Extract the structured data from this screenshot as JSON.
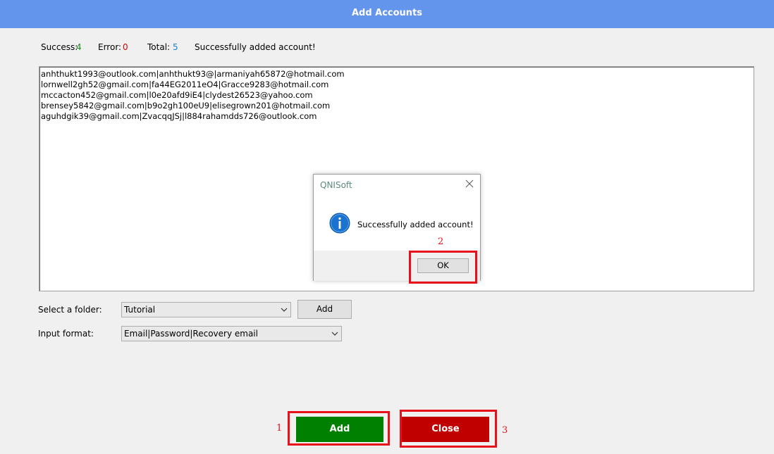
{
  "window": {
    "title": "Add Accounts"
  },
  "stats": {
    "success_label": "Success:",
    "success_value": "4",
    "error_label": "Error:",
    "error_value": "0",
    "total_label": "Total:",
    "total_value": "5",
    "status_message": "Successfully added account!"
  },
  "accounts_text": [
    "anhthukt1993@outlook.com|anhthukt93@|armaniyah65872@hotmail.com",
    "lornwell2gh52@gmail.com|fa44EG2011eO4|Gracce9283@hotmail.com",
    "mccacton452@gmail.com|l0e20afd9iE4|clydest26523@yahoo.com",
    "brensey5842@gmail.com|b9o2gh100eU9|elisegrown201@hotmail.com",
    "aguhdgik39@gmail.com|ZvacqqJSj|l884rahamdds726@outlook.com"
  ],
  "form": {
    "folder_label": "Select a folder:",
    "folder_value": "Tutorial",
    "folder_add_label": "Add",
    "format_label": "Input format:",
    "format_value": "Email|Password|Recovery email"
  },
  "buttons": {
    "add_label": "Add",
    "close_label": "Close"
  },
  "dialog": {
    "title": "QNISoft",
    "message": "Successfully added account!",
    "ok_label": "OK",
    "icon": "info-icon"
  },
  "annotations": {
    "n1": "1",
    "n2": "2",
    "n3": "3"
  },
  "colors": {
    "titlebar": "#6495ed",
    "add_button": "#008000",
    "close_button": "#c00000",
    "highlight": "#e8101a",
    "success": "#1a8a1a",
    "error": "#e00000",
    "total": "#1e7fd1"
  }
}
